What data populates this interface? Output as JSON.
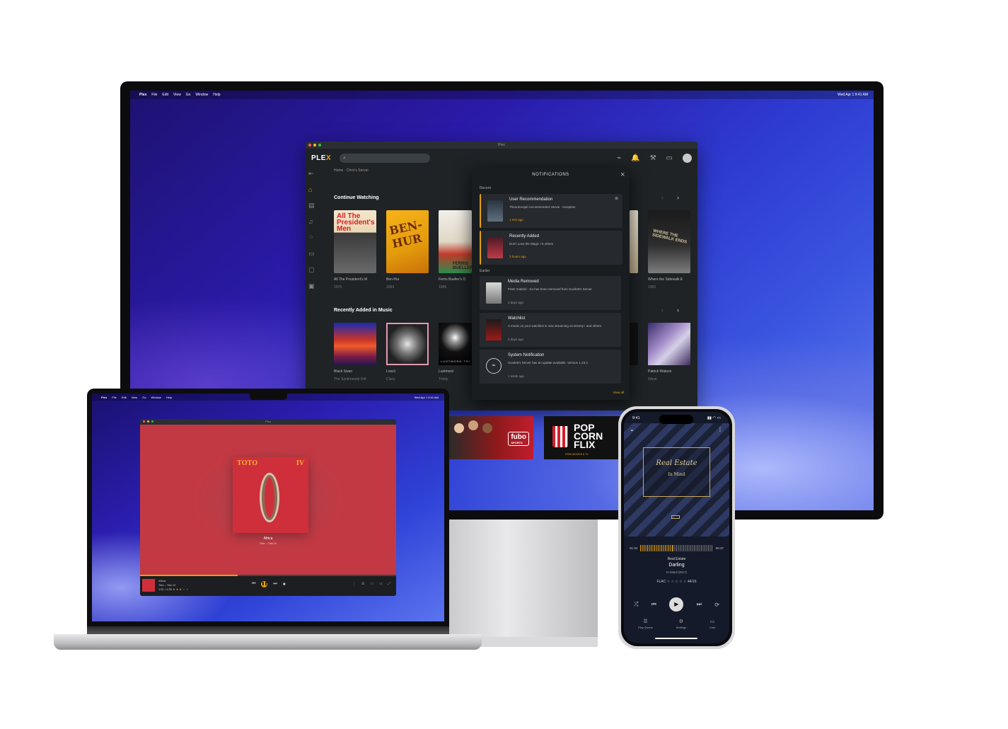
{
  "desktop": {
    "menubar": {
      "apple": "",
      "app": "Plex",
      "items": [
        "File",
        "Edit",
        "View",
        "Go",
        "Window",
        "Help"
      ],
      "clock": "Wed Apr 1  9:41 AM"
    },
    "window_title": "Plex",
    "logo_main": "PLE",
    "logo_accent": "X",
    "search_icon": "⌕",
    "top_icons": {
      "activity": "⌁",
      "bell": "🔔",
      "wrench": "⚒",
      "cast": "▭"
    },
    "breadcrumb": "Home · Chris's Server",
    "continue_watching": {
      "title": "Continue Watching",
      "items": [
        {
          "poster_text": "All The President's Men",
          "title": "All The President's M",
          "year": "1976"
        },
        {
          "poster_text": "BEN-HUR",
          "title": "Ben-Hur",
          "year": "1959"
        },
        {
          "poster_text": "FERRIS BUELLER",
          "title": "Ferris Bueller's D",
          "year": "1986"
        },
        {
          "poster_text": "WHERE THE SIDEWALK ENDS",
          "title": "Where the Sidewalk E",
          "year": "1950"
        }
      ]
    },
    "recently_added_music": {
      "title": "Recently Added in Music",
      "items": [
        {
          "title": "Black Swan",
          "subtitle": "The Sentimental Drif"
        },
        {
          "title": "Loscil",
          "subtitle": "Clara"
        },
        {
          "title": "Lustmord",
          "subtitle": "Trinity",
          "art_text": "LUSTMORD   TRI"
        },
        {
          "title": "Patrick Watson",
          "subtitle": "Wave"
        }
      ]
    },
    "notifications": {
      "title": "NOTIFICATIONS",
      "recent_label": "Recent",
      "earlier_label": "Earlier",
      "items": [
        {
          "title": "User Recommendation",
          "body": "Theordorejub recommended: Movie · Inception",
          "time": "1 min ago"
        },
        {
          "title": "Recently Added",
          "body": "Don't Lose the Magic +5 others",
          "time": "3 hours ago"
        },
        {
          "title": "Media Removed",
          "body": "Peter Gabriel - So has been removed from Scarlett's Server",
          "time": "2 days ago"
        },
        {
          "title": "Watchlist",
          "body": "A movie on your watchlist is now streaming on Disney+ and others",
          "time": "6 days ago"
        },
        {
          "title": "System Notification",
          "body": "Scarlett's Server has an update available. Version 1.23.4",
          "time": "1 week ago"
        }
      ],
      "view_all": "View all"
    },
    "banners": {
      "fubo": "fubo",
      "fubo_sub": "SPORTS",
      "popcorn": [
        "POP",
        "CORN",
        "FLIX"
      ],
      "popcorn_sub": "FREE MOVIES & TV"
    }
  },
  "laptop": {
    "menubar": {
      "app": "Plex",
      "items": [
        "File",
        "Edit",
        "View",
        "Go",
        "Window",
        "Help"
      ],
      "clock": "Wed Apr 1  9:41 AM"
    },
    "window_title": "Plex",
    "album_left": "TOTO",
    "album_right": "IV",
    "track": "Africa",
    "artist_album": "Toto – Toto IV",
    "player": {
      "line1": "Africa",
      "line2": "Toto – Toto IV",
      "line3": "1:51 / 4:55",
      "progress": 0.38
    }
  },
  "phone": {
    "time": "9:41",
    "cover_title": "Real Estate",
    "cover_subtitle": "In Mind",
    "elapsed": "01:34",
    "remaining": "06:37",
    "artist": "Real Estate",
    "track": "Darling",
    "album": "In Mind (2017)",
    "format": "FLAC",
    "stars": "☆ ☆ ☆ ☆ ☆",
    "quality": "44/16",
    "tabs": [
      "Play Queue",
      "Settings",
      "Cast"
    ]
  }
}
